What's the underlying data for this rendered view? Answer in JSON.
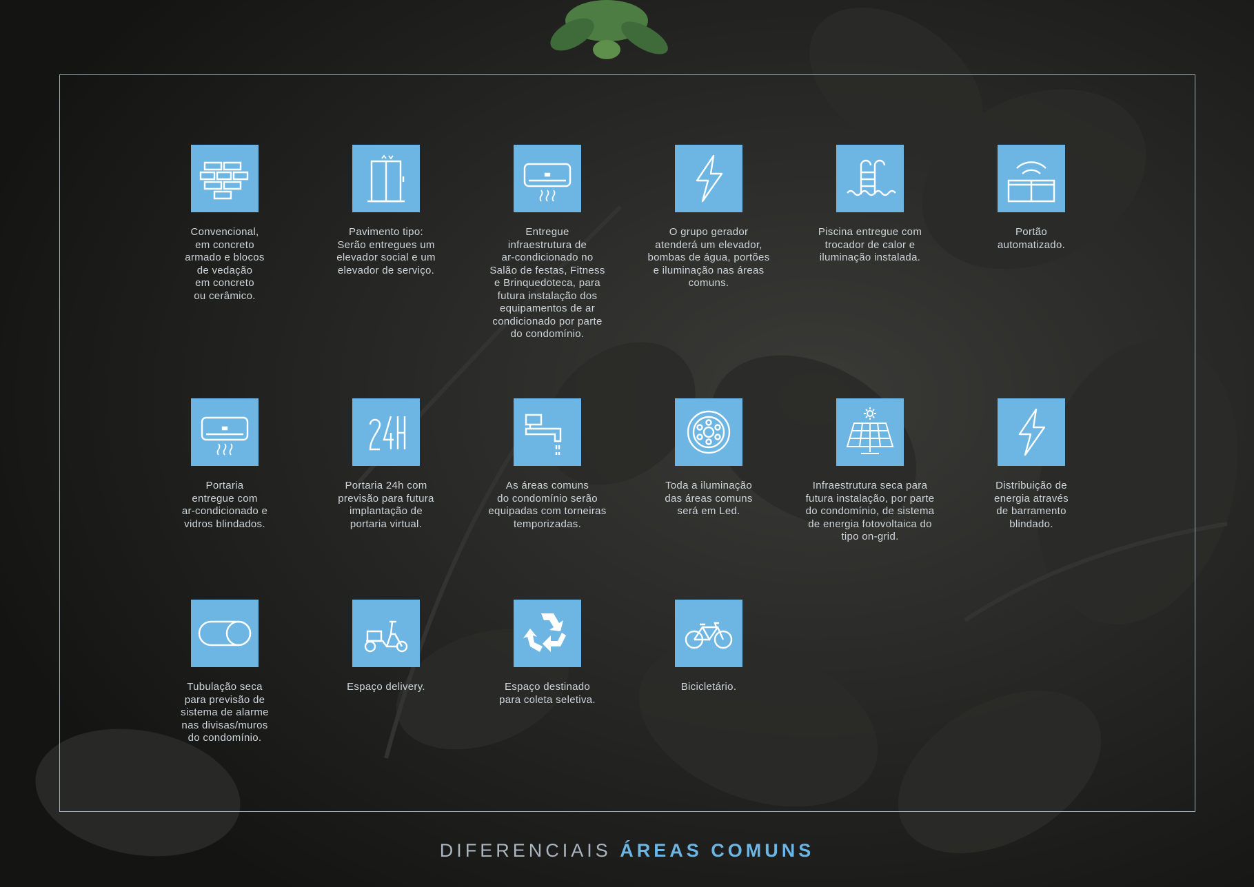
{
  "items": [
    {
      "icon": "brick-wall-icon",
      "caption": "Convencional,\nem concreto\narmado e blocos\nde vedação\nem concreto\nou cerâmico."
    },
    {
      "icon": "elevator-icon",
      "caption": "Pavimento tipo:\nSerão entregues um\nelevador social e um\nelevador de serviço."
    },
    {
      "icon": "air-conditioner-icon",
      "caption": "Entregue\ninfraestrutura de\nar-condicionado no\nSalão de festas, Fitness\ne Brinquedoteca, para\nfutura instalação dos\nequipamentos de ar\ncondicionado por parte\ndo condomínio."
    },
    {
      "icon": "lightning-bolt-icon",
      "caption": "O grupo gerador\natenderá um elevador,\nbombas de água, portões\ne iluminação nas áreas\ncomuns."
    },
    {
      "icon": "pool-ladder-icon",
      "caption": "Piscina entregue com\ntrocador de calor e\niluminação instalada."
    },
    {
      "icon": "automatic-gate-icon",
      "caption": "Portão\nautomatizado."
    },
    {
      "icon": "air-conditioner-icon",
      "caption": "Portaria\nentregue com\nar-condicionado e\nvidros blindados."
    },
    {
      "icon": "24h-icon",
      "caption": "Portaria 24h com\nprevisão para futura\nimplantação de\nportaria virtual."
    },
    {
      "icon": "faucet-icon",
      "caption": "As áreas comuns\ndo condomínio serão\nequipadas com torneiras\ntemporizadas."
    },
    {
      "icon": "led-light-icon",
      "caption": "Toda a iluminação\ndas áreas comuns\nserá em Led."
    },
    {
      "icon": "solar-panel-icon",
      "caption": "Infraestrutura seca para\nfutura instalação, por parte\ndo condomínio, de sistema\nde energia fotovoltaica do\ntipo on-grid."
    },
    {
      "icon": "lightning-bolt-icon",
      "caption": "Distribuição de\nenergia através\nde barramento\nblindado."
    },
    {
      "icon": "alarm-toggle-icon",
      "caption": "Tubulação seca\npara previsão de\nsistema de alarme\nnas divisas/muros\ndo condomínio."
    },
    {
      "icon": "delivery-scooter-icon",
      "caption": "Espaço delivery."
    },
    {
      "icon": "recycle-icon",
      "caption": "Espaço destinado\npara coleta seletiva."
    },
    {
      "icon": "bicycle-icon",
      "caption": "Bicicletário."
    }
  ],
  "footer": {
    "light": "DIFERENCIAIS",
    "bold": "ÁREAS COMUNS"
  },
  "colors": {
    "accent": "#6db5e3",
    "background": "#161615",
    "text": "#cfd6db"
  }
}
